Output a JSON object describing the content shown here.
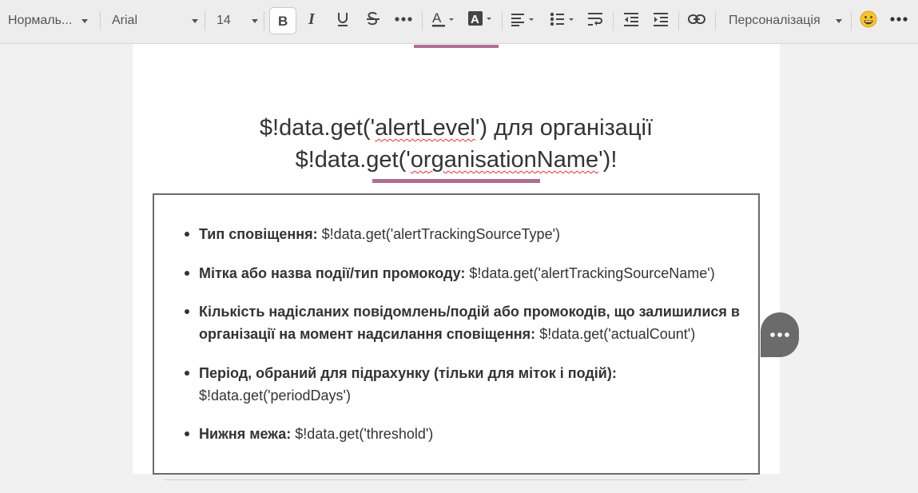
{
  "toolbar": {
    "paragraph_style": "Нормаль...",
    "font_family": "Arial",
    "font_size": "14",
    "personalization": "Персоналізація",
    "icons": [
      "bold-icon",
      "italic-icon",
      "underline-icon",
      "strikethrough-icon",
      "more-icon",
      "font-color-icon",
      "highlight-icon",
      "align-icon",
      "list-icon",
      "wrap-icon",
      "outdent-icon",
      "indent-icon",
      "link-icon",
      "emoji-icon",
      "more-icon"
    ]
  },
  "heading": {
    "line1_prefix": "$!data.get('",
    "line1_var": "alertLevel",
    "line1_suffix": "') для організації",
    "line2_prefix": "$!data.get('",
    "line2_var": "organisationName",
    "line2_suffix": "')!"
  },
  "items": [
    {
      "label": "Тип сповіщення:",
      "value": "$!data.get('alertTrackingSourceType')"
    },
    {
      "label": "Мітка або назва події/тип промокоду:",
      "value": "$!data.get('alertTrackingSourceName')"
    },
    {
      "label": "Кількість надісланих повідомлень/подій або промокодів, що залишилися в організації на момент надсилання сповіщення:",
      "value": "$!data.get('actualCount')"
    },
    {
      "label": "Період, обраний для підрахунку (тільки для міток і подій):",
      "value": "$!data.get('periodDays')"
    },
    {
      "label": "Нижня межа:",
      "value": "$!data.get('threshold')"
    }
  ],
  "colors": {
    "accent": "#b06e93",
    "toolbar_bg": "#ededed",
    "box_border": "#6b6b6b"
  }
}
